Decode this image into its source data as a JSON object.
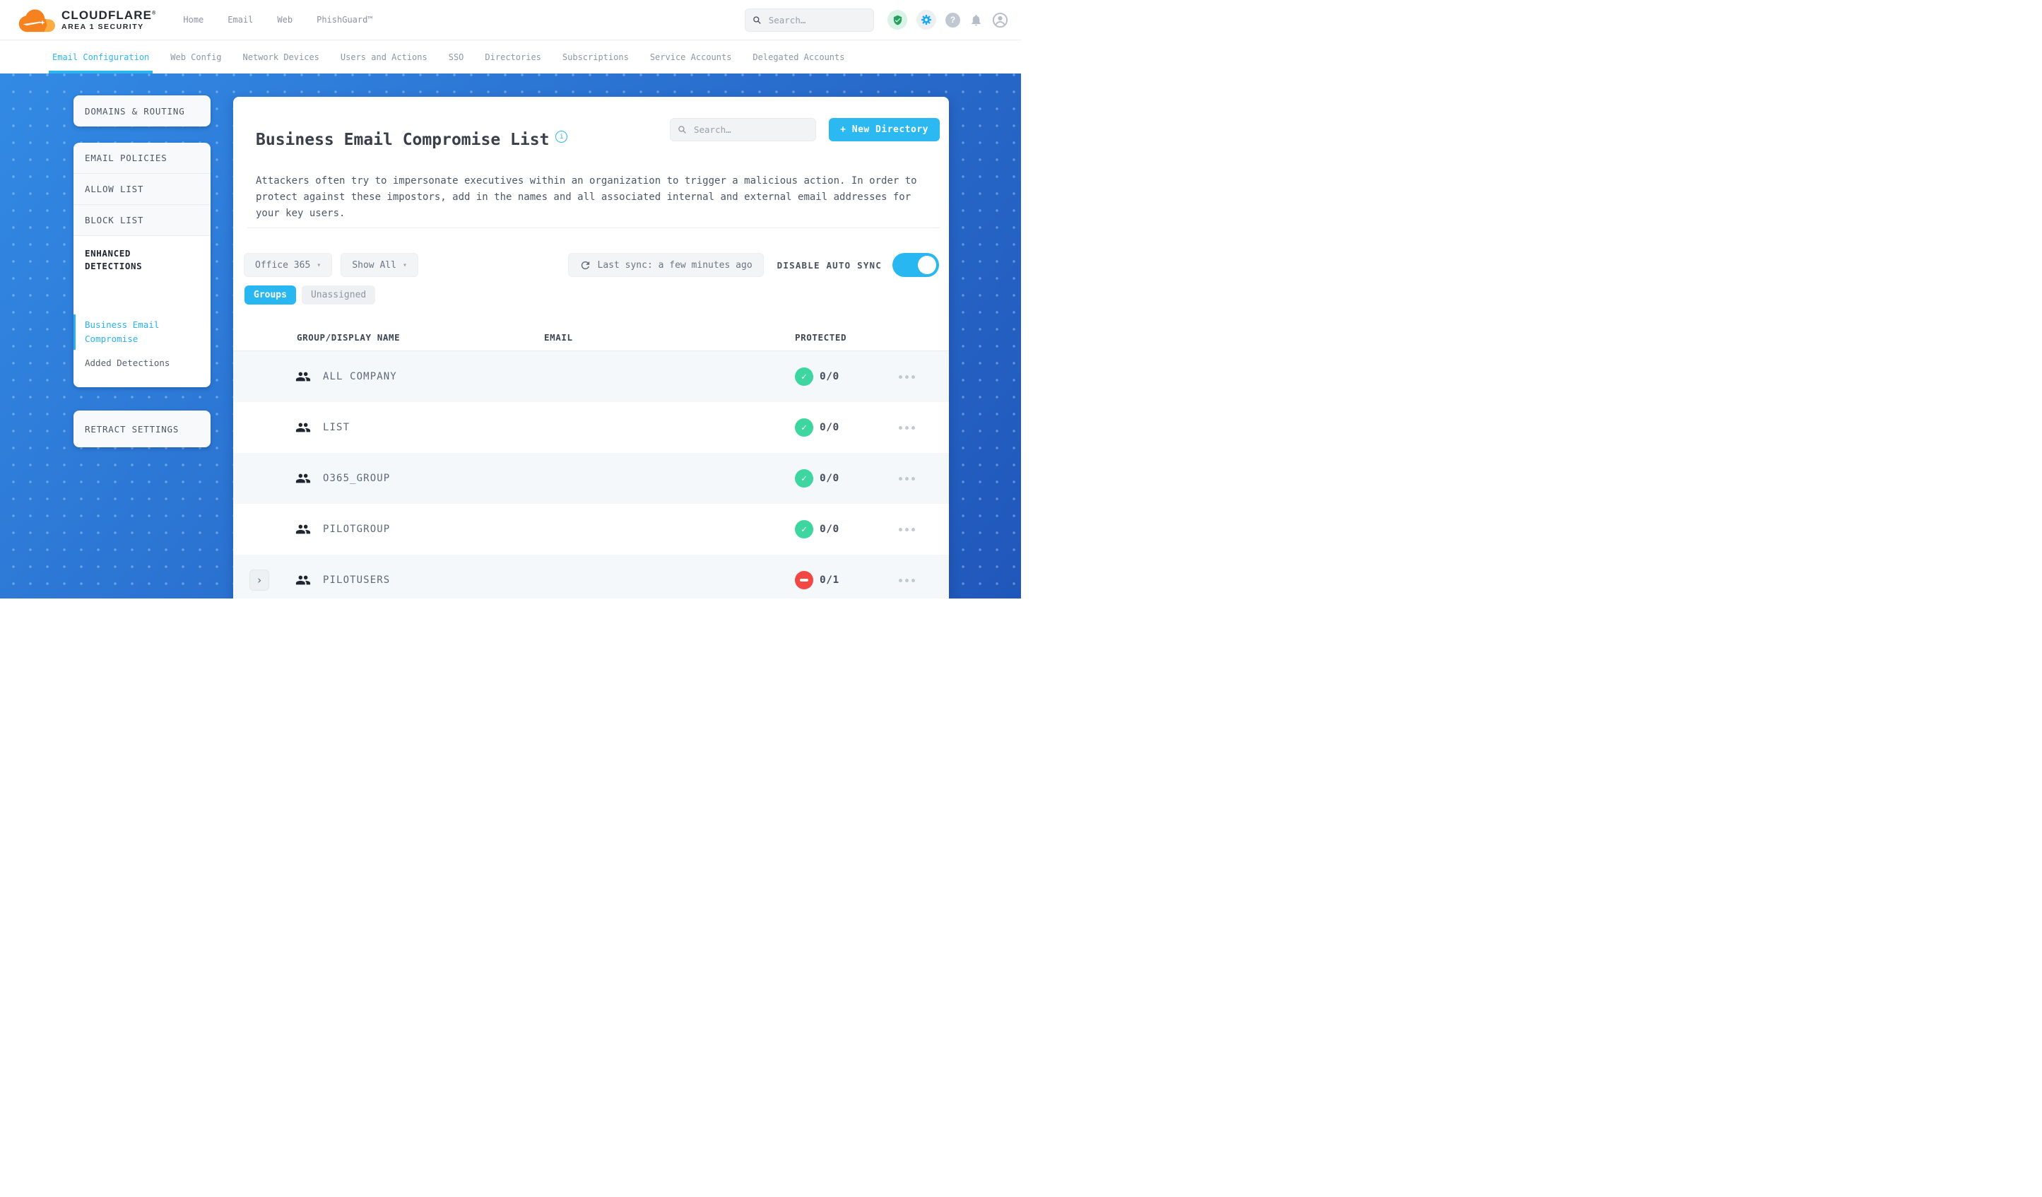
{
  "colors": {
    "accent": "#2cb6f0",
    "success": "#3ed6a0",
    "danger": "#f24743",
    "brand_orange": "#f6821f"
  },
  "brand": {
    "name": "CLOUDFLARE",
    "mark": "®",
    "subname": "AREA 1 SECURITY"
  },
  "topbar": {
    "nav": [
      {
        "label": "Home"
      },
      {
        "label": "Email"
      },
      {
        "label": "Web"
      },
      {
        "label": "PhishGuard™"
      }
    ],
    "search_placeholder": "Search…",
    "help_glyph": "?"
  },
  "subnav": {
    "items": [
      {
        "label": "Email Configuration",
        "active": true
      },
      {
        "label": "Web Config"
      },
      {
        "label": "Network Devices"
      },
      {
        "label": "Users and Actions"
      },
      {
        "label": "SSO"
      },
      {
        "label": "Directories"
      },
      {
        "label": "Subscriptions"
      },
      {
        "label": "Service Accounts"
      },
      {
        "label": "Delegated Accounts"
      }
    ]
  },
  "sidebar": {
    "domains_routing": "DOMAINS & ROUTING",
    "email_policies": "EMAIL POLICIES",
    "allow_list": "ALLOW LIST",
    "block_list": "BLOCK LIST",
    "enhanced_detections": "ENHANCED DETECTIONS",
    "business_email_compromise": "Business Email Compromise",
    "added_detections": "Added Detections",
    "retract_settings": "RETRACT SETTINGS"
  },
  "main": {
    "title": "Business Email Compromise List",
    "info_glyph": "i",
    "search_placeholder": "Search…",
    "new_directory_button": "+ New Directory",
    "description": "Attackers often try to impersonate executives within an organization to trigger a malicious action. In order to protect against these impostors, add in the names and all associated internal and external email addresses for your key users.",
    "filters": {
      "directory": "Office 365",
      "show": "Show All",
      "caret": "▾",
      "last_sync": "Last sync: a few minutes ago",
      "auto_sync_label": "DISABLE AUTO SYNC",
      "auto_sync_on": true
    },
    "tabs": [
      {
        "label": "Groups",
        "active": true
      },
      {
        "label": "Unassigned"
      }
    ],
    "table": {
      "headers": [
        "GROUP/DISPLAY NAME",
        "EMAIL",
        "PROTECTED"
      ],
      "check_glyph": "✓",
      "expand_glyph": "›",
      "rows": [
        {
          "name": "ALL COMPANY",
          "protected": "0/0",
          "status": "protected"
        },
        {
          "name": "LIST",
          "protected": "0/0",
          "status": "protected"
        },
        {
          "name": "O365_GROUP",
          "protected": "0/0",
          "status": "protected"
        },
        {
          "name": "PILOTGROUP",
          "protected": "0/0",
          "status": "protected"
        },
        {
          "name": "PILOTUSERS",
          "protected": "0/1",
          "status": "not_protected",
          "expandable": true
        }
      ]
    }
  }
}
